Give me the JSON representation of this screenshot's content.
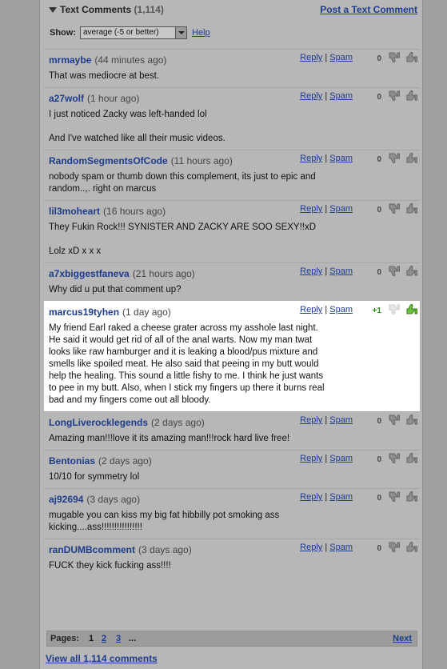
{
  "header": {
    "title": "Text Comments",
    "count": "(1,114)",
    "post_link": "Post a Text Comment"
  },
  "filter": {
    "label": "Show:",
    "selected": "average (-5 or better)",
    "help": "Help"
  },
  "actions": {
    "reply": "Reply",
    "sep": "|",
    "spam": "Spam"
  },
  "comments": [
    {
      "author": "mrmaybe",
      "time": "(44 minutes ago)",
      "score": "0",
      "highlight": false,
      "text": "That was mediocre at best."
    },
    {
      "author": "a27wolf",
      "time": "(1 hour ago)",
      "score": "0",
      "highlight": false,
      "text": "I just noticed Zacky was left-handed lol\n\nAnd I've watched like all their music videos."
    },
    {
      "author": "RandomSegmentsOfCode",
      "time": "(11 hours ago)",
      "score": "0",
      "highlight": false,
      "text": "nobody spam or thumb down this complement, its just to epic and random..,. right on marcus"
    },
    {
      "author": "lil3moheart",
      "time": "(16 hours ago)",
      "score": "0",
      "highlight": false,
      "text": "They Fukin Rock!!! SYNISTER AND ZACKY ARE SOO SEXY!!xD\n\nLolz xD x x x"
    },
    {
      "author": "a7xbiggestfaneva",
      "time": "(21 hours ago)",
      "score": "0",
      "highlight": false,
      "text": "Why did u put that comment up?"
    },
    {
      "author": "marcus19tyhen",
      "time": "(1 day ago)",
      "score": "+1",
      "highlight": true,
      "text": "My friend Earl raked a cheese grater across my asshole last night. He said it would get rid of all of the anal warts. Now my man twat looks like raw hamburger and it is leaking a blood/pus mixture and smells like spoiled meat. He also said that peeing in my butt would help the healing. This sound a little fishy to me. I think he just wants to pee in my butt. Also, when I stick my fingers up there it burns real bad and my fingers come out all bloody."
    },
    {
      "author": "LongLiverocklegends",
      "time": "(2 days ago)",
      "score": "0",
      "highlight": false,
      "text": "Amazing man!!!love it its amazing man!!!rock hard live free!"
    },
    {
      "author": "Bentonias",
      "time": "(2 days ago)",
      "score": "0",
      "highlight": false,
      "text": "10/10 for symmetry lol"
    },
    {
      "author": "aj92694",
      "time": "(3 days ago)",
      "score": "0",
      "highlight": false,
      "text": "mugable you can kiss my big fat hibbilly pot smoking ass kicking....ass!!!!!!!!!!!!!!!!"
    },
    {
      "author": "ranDUMBcomment",
      "time": "(3 days ago)",
      "score": "0",
      "highlight": false,
      "text": "FUCK they kick fucking ass!!!!"
    }
  ],
  "pager": {
    "label": "Pages:",
    "current": "1",
    "pages": [
      "2",
      "3"
    ],
    "ellipsis": "...",
    "next": "Next"
  },
  "view_all": "View all 1,114 comments",
  "colors": {
    "link": "#1d3c8c",
    "panel": "#b7b7b7",
    "highlight": "#ffffff",
    "positive": "#2c8a1c"
  }
}
